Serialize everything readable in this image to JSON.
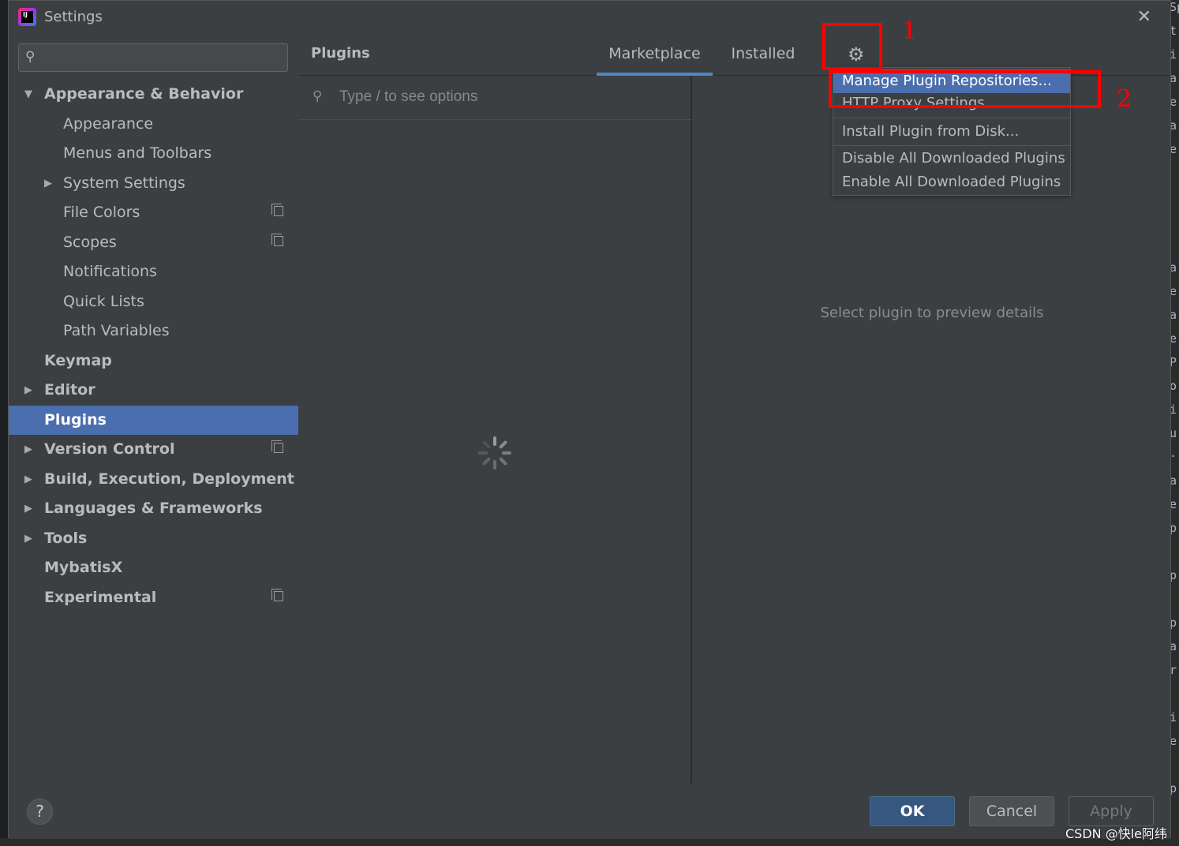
{
  "window": {
    "title": "Settings",
    "logo_text": "IJ"
  },
  "sidebar": {
    "search_placeholder": "",
    "items": [
      {
        "label": "Appearance & Behavior",
        "expanded": true
      },
      {
        "label": "Appearance"
      },
      {
        "label": "Menus and Toolbars"
      },
      {
        "label": "System Settings"
      },
      {
        "label": "File Colors"
      },
      {
        "label": "Scopes"
      },
      {
        "label": "Notifications"
      },
      {
        "label": "Quick Lists"
      },
      {
        "label": "Path Variables"
      },
      {
        "label": "Keymap"
      },
      {
        "label": "Editor"
      },
      {
        "label": "Plugins",
        "selected": true
      },
      {
        "label": "Version Control"
      },
      {
        "label": "Build, Execution, Deployment"
      },
      {
        "label": "Languages & Frameworks"
      },
      {
        "label": "Tools"
      },
      {
        "label": "MybatisX"
      },
      {
        "label": "Experimental"
      }
    ]
  },
  "plugins": {
    "title": "Plugins",
    "tabs": [
      {
        "label": "Marketplace",
        "active": true
      },
      {
        "label": "Installed"
      }
    ],
    "search_placeholder": "Type / to see options",
    "preview_message": "Select plugin to preview details"
  },
  "gear_menu": {
    "items": [
      {
        "label": "Manage Plugin Repositories...",
        "highlighted": true
      },
      {
        "label": "HTTP Proxy Settings..."
      },
      {
        "label": "Install Plugin from Disk..."
      },
      {
        "label": "Disable All Downloaded Plugins"
      },
      {
        "label": "Enable All Downloaded Plugins"
      }
    ]
  },
  "footer": {
    "help": "?",
    "ok": "OK",
    "cancel": "Cancel",
    "apply": "Apply"
  },
  "annotations": {
    "one": "1",
    "two": "2"
  },
  "watermark": "CSDN @快le阿纬",
  "background_glyphs": [
    "Sp",
    "t",
    "i",
    "a",
    "e",
    "a",
    "e",
    "a",
    "e",
    "a",
    "e",
    "P",
    "o",
    "i",
    "u",
    ".",
    "a",
    "e",
    "p",
    "p",
    "p",
    "a",
    "r",
    "i",
    "e",
    "",
    "p"
  ],
  "colors": {
    "accent": "#4b6eaf",
    "tab_underline": "#4a88c7",
    "annotation": "#ff0000",
    "ok_button": "#365880"
  }
}
